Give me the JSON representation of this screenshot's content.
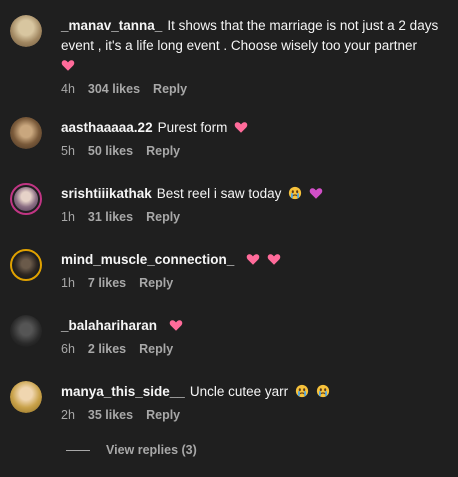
{
  "comments": [
    {
      "username": "_manav_tanna_",
      "text": "It shows that the marriage is not just a 2 days event , it's a life long event . Choose wisely too your partner",
      "time": "4h",
      "likes": "304 likes",
      "reply": "Reply",
      "emojis": [
        "pink-heart-icon"
      ],
      "avatar_color": "#b8a27e"
    },
    {
      "username": "aasthaaaaa.22",
      "text": "Purest form",
      "time": "5h",
      "likes": "50 likes",
      "reply": "Reply",
      "emojis": [
        "pink-heart-icon"
      ],
      "avatar_color": "#8a6b4a"
    },
    {
      "username": "srishtiiikathak",
      "text": "Best reel i saw today",
      "time": "1h",
      "likes": "31 likes",
      "reply": "Reply",
      "emojis": [
        "crying-face-icon",
        "purple-heart-icon"
      ],
      "avatar_color": "#6a4f74"
    },
    {
      "username": "mind_muscle_connection_",
      "text": "",
      "time": "1h",
      "likes": "7 likes",
      "reply": "Reply",
      "emojis": [
        "pink-heart-icon",
        "pink-heart-icon"
      ],
      "avatar_color": "#3a3530"
    },
    {
      "username": "_balahariharan",
      "text": "",
      "time": "6h",
      "likes": "2 likes",
      "reply": "Reply",
      "emojis": [
        "pink-heart-icon"
      ],
      "avatar_color": "#2e2e2e"
    },
    {
      "username": "manya_this_side__",
      "text": "Uncle cutee yarr",
      "time": "2h",
      "likes": "35 likes",
      "reply": "Reply",
      "emojis": [
        "crying-face-icon",
        "crying-face-icon"
      ],
      "avatar_color": "#c9a24a"
    }
  ],
  "view_replies": "View replies (3)"
}
